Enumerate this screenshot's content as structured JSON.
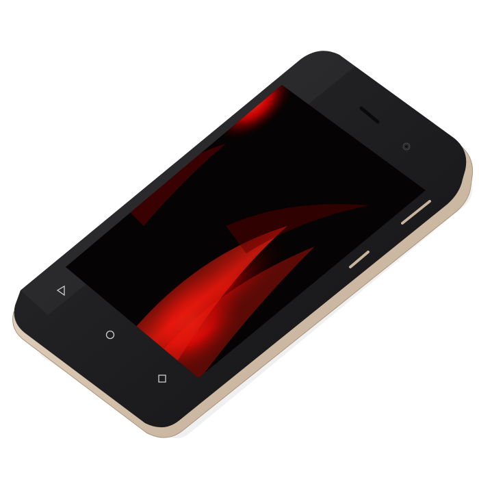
{
  "photo": {
    "subject": "smartphone",
    "background_color": "#ffffff",
    "frame_color": "#d8c7b4",
    "frame_shadow_color": "#b9a792",
    "body_color": "#1b1b1d",
    "screen_color": "#050303",
    "wallpaper_colors": [
      "#ff1a12",
      "#c40000",
      "#5a0000",
      "#000000"
    ]
  },
  "nav_keys": [
    {
      "name": "back",
      "glyph": "◁"
    },
    {
      "name": "home",
      "glyph": "○"
    },
    {
      "name": "recents",
      "glyph": "□"
    }
  ]
}
